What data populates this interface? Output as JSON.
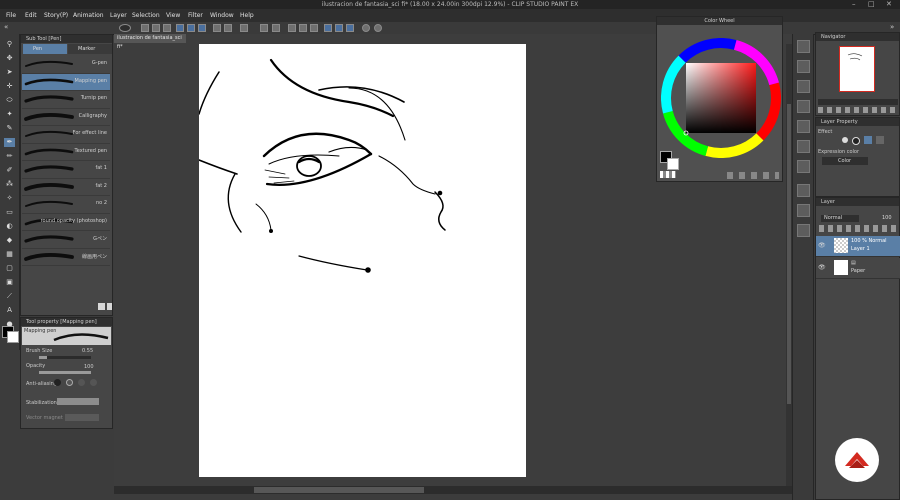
{
  "window": {
    "title": "ilustracion de fantasia_sci fi* (18.00 x 24.00in 300dpi 12.9%) - CLIP STUDIO PAINT EX",
    "controls": [
      "–",
      "□",
      "✕"
    ]
  },
  "menu": [
    "File",
    "Edit",
    "Story(P)",
    "Animation",
    "Layer",
    "Selection",
    "View",
    "Filter",
    "Window",
    "Help"
  ],
  "doc_tab": "ilustracion de fantasia_sci fi*",
  "subtool": {
    "title": "Sub Tool [Pen]",
    "tabs": [
      "Pen",
      "Marker"
    ],
    "brushes": [
      {
        "label": "G-pen",
        "selected": false
      },
      {
        "label": "Mapping pen",
        "selected": true
      },
      {
        "label": "Turnip pen",
        "selected": false
      },
      {
        "label": "Calligraphy",
        "selected": false
      },
      {
        "label": "For effect line",
        "selected": false
      },
      {
        "label": "Textured pen",
        "selected": false
      },
      {
        "label": "fat 1",
        "selected": false
      },
      {
        "label": "fat 2",
        "selected": false
      },
      {
        "label": "no 2",
        "selected": false
      },
      {
        "label": "round opacity (photoshop)",
        "selected": false
      },
      {
        "label": "Gペン",
        "selected": false
      },
      {
        "label": "線画用ペン",
        "selected": false
      }
    ]
  },
  "toolprop": {
    "title": "Tool property [Mapping pen]",
    "preview_label": "Mapping pen",
    "brush_size_label": "Brush Size",
    "brush_size_value": "0.55",
    "brush_size_fraction": 0.15,
    "opacity_label": "Opacity",
    "opacity_value": "100",
    "opacity_fraction": 1.0,
    "anti_aliasing_label": "Anti-aliasing",
    "stabilization_label": "Stabilization",
    "vector_magnet_label": "Vector magnet"
  },
  "colorwheel": {
    "title": "Color Wheel"
  },
  "navigator": {
    "title": "Navigator"
  },
  "layerprop": {
    "title": "Layer Property",
    "effect_label": "Effect",
    "expression_label": "Expression color",
    "expression_value": "Color"
  },
  "layer": {
    "title": "Layer",
    "blend_mode": "Normal",
    "opacity": "100",
    "layers": [
      {
        "label_top": "100 % Normal",
        "label_bottom": "Layer 1",
        "selected": true
      },
      {
        "label_top": "",
        "label_bottom": "Paper",
        "selected": false
      }
    ]
  },
  "colors": {
    "accent_blue": "#5a7fa6",
    "logo_red": "#d32a20",
    "main_color": "#000000",
    "sub_color": "#ffffff"
  }
}
